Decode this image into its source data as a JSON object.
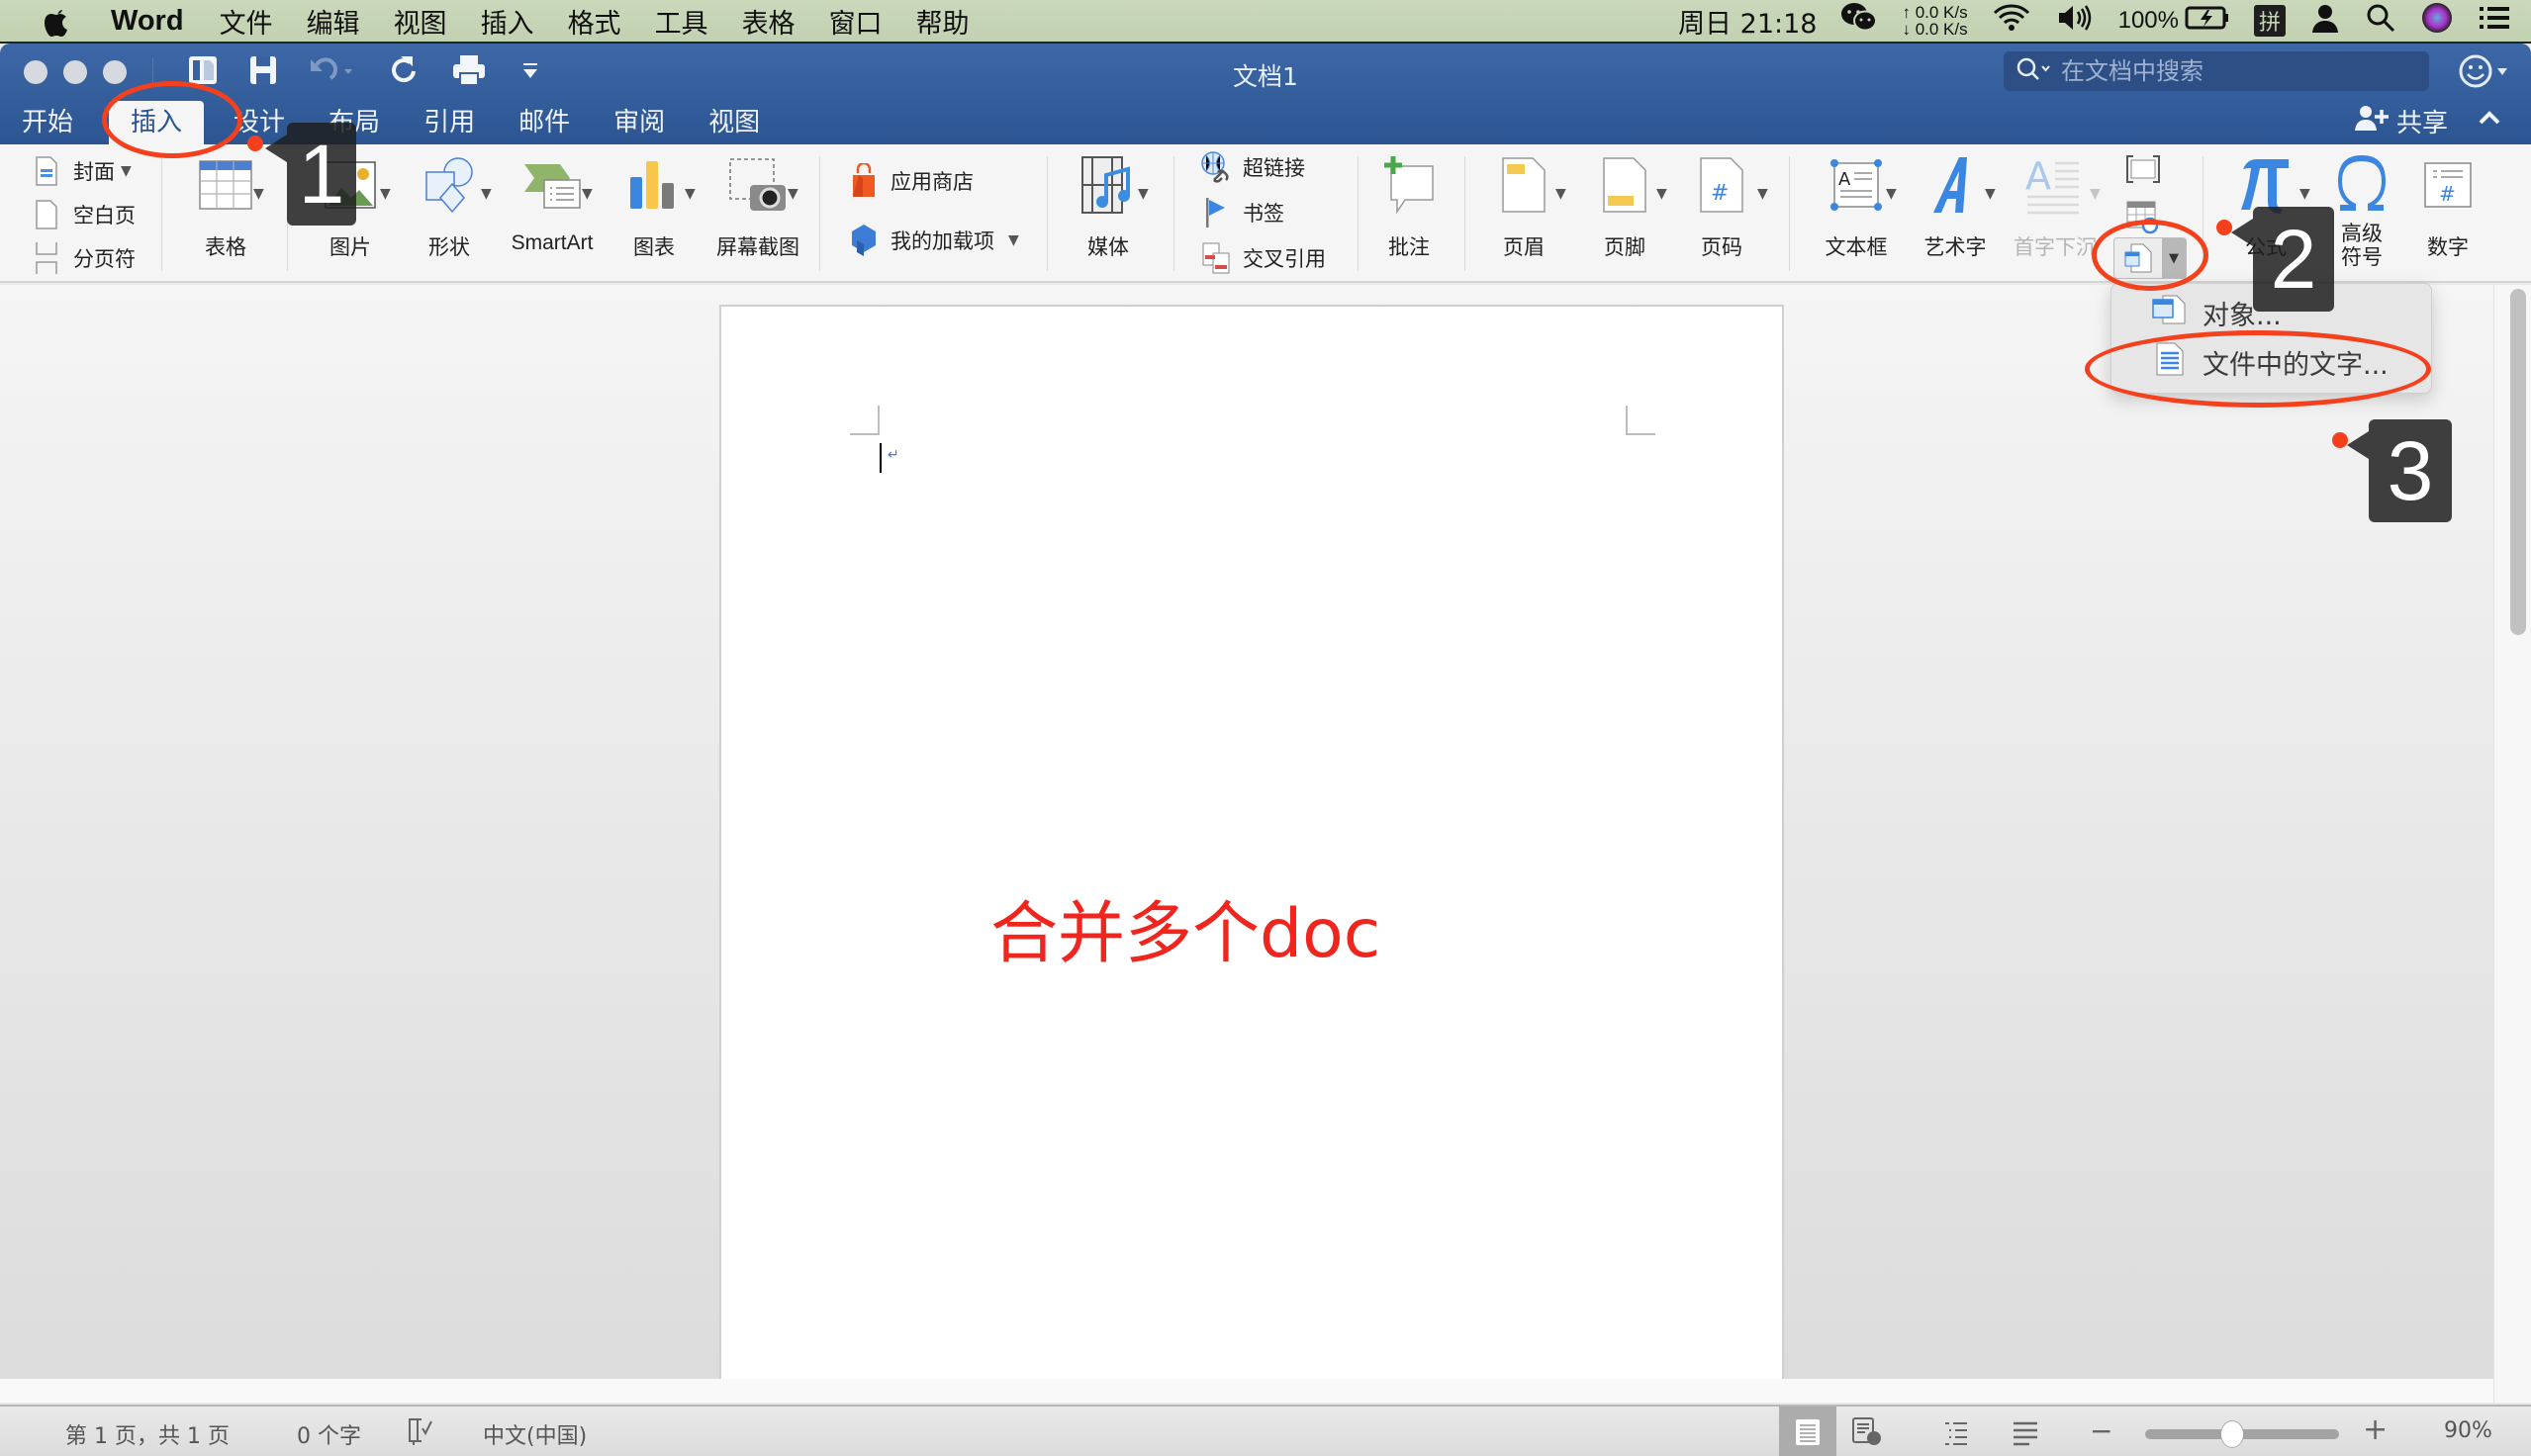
{
  "menubar": {
    "app_name": "Word",
    "items": [
      "文件",
      "编辑",
      "视图",
      "插入",
      "格式",
      "工具",
      "表格",
      "窗口",
      "帮助"
    ],
    "clock": "周日 21:18",
    "net_up": "↑ 0.0 K/s",
    "net_down": "↓ 0.0 K/s",
    "battery": "100%",
    "input_method": "拼"
  },
  "window": {
    "title": "文档1",
    "search_placeholder": "在文档中搜索",
    "share_label": "共享",
    "tabs": [
      "开始",
      "插入",
      "设计",
      "布局",
      "引用",
      "邮件",
      "审阅",
      "视图"
    ],
    "active_tab": "插入"
  },
  "ribbon": {
    "pages": {
      "cover": "封面",
      "blank": "空白页",
      "break": "分页符"
    },
    "table": "表格",
    "picture": "图片",
    "shapes": "形状",
    "smartart": "SmartArt",
    "chart": "图表",
    "screenshot": "屏幕截图",
    "store": "应用商店",
    "addins": "我的加载项",
    "media": "媒体",
    "hyperlink": "超链接",
    "bookmark": "书签",
    "crossref": "交叉引用",
    "comment": "批注",
    "header": "页眉",
    "footer": "页脚",
    "pagenum": "页码",
    "textbox": "文本框",
    "wordart": "艺术字",
    "dropcap": "首字下沉",
    "equation": "公式",
    "symbol": "高级\n符号",
    "symbol_line1": "高级",
    "symbol_line2": "符号",
    "number": "数字"
  },
  "object_menu": {
    "items": [
      "对象...",
      "文件中的文字..."
    ]
  },
  "document": {
    "headline": "合并多个doc"
  },
  "annotations": {
    "steps": [
      "1",
      "2",
      "3"
    ],
    "color": "#f4401d"
  },
  "statusbar": {
    "page_info": "第 1 页，共 1 页",
    "word_count": "0 个字",
    "language": "中文(中国)",
    "zoom_level": "90%",
    "zoom_fraction": 0.45
  }
}
